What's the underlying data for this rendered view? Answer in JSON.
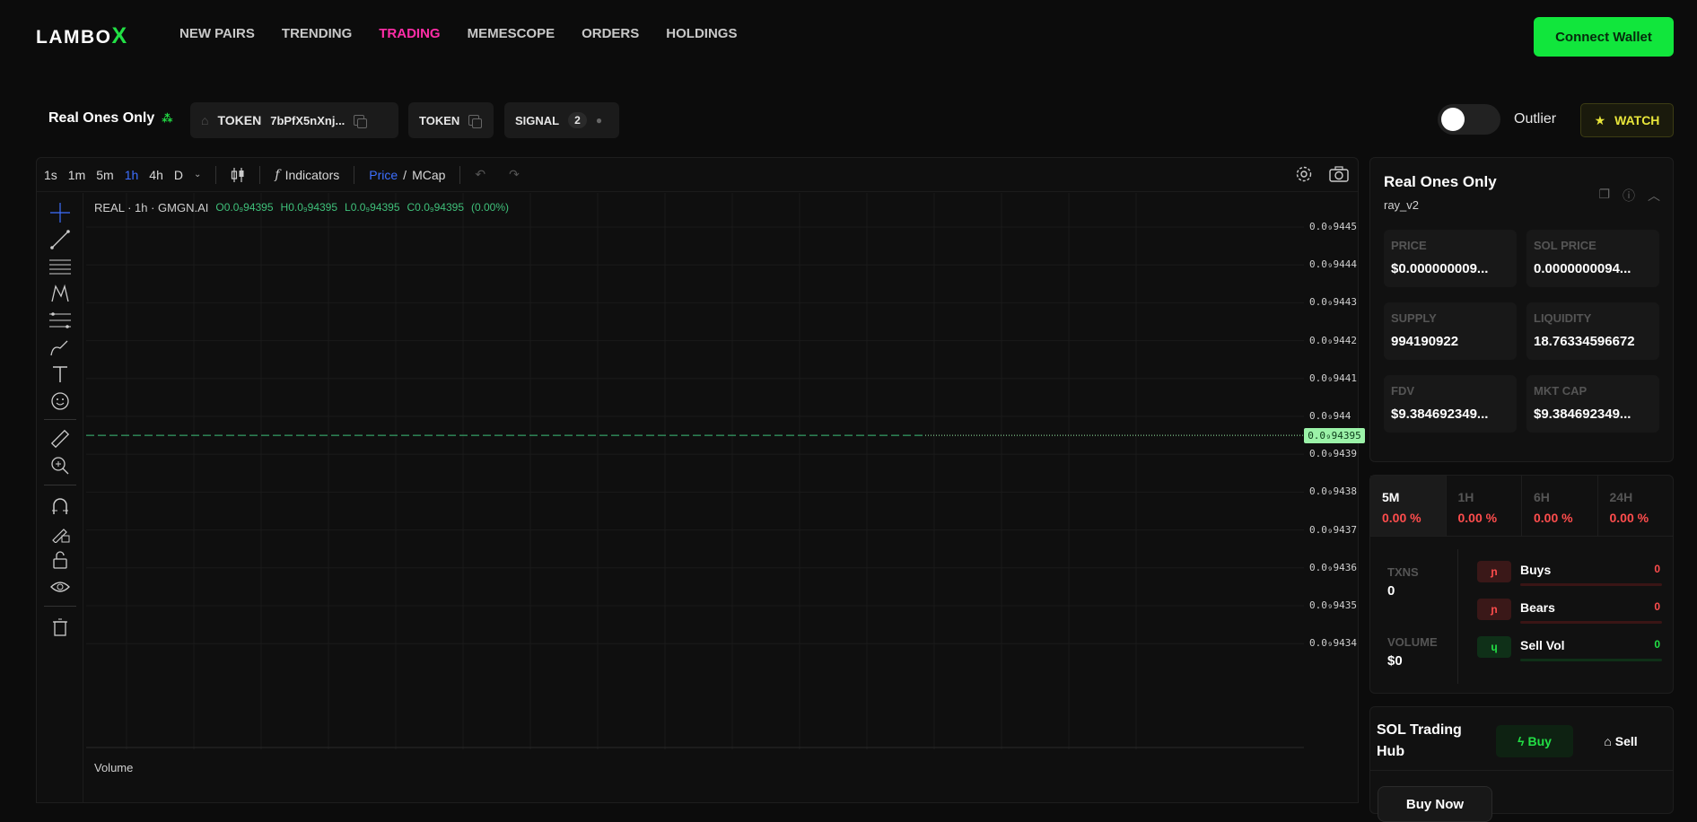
{
  "brand": {
    "logo_main": "LAMBO",
    "logo_x": "X"
  },
  "nav": [
    "NEW PAIRS",
    "TRENDING",
    "TRADING",
    "MEMESCOPE",
    "ORDERS",
    "HOLDINGS"
  ],
  "nav_active": "TRADING",
  "connect_label": "Connect Wallet",
  "infobar": {
    "token_name": "Real Ones Only",
    "chip1_label": "TOKEN",
    "chip1_address": "7bPfX5nXnj...",
    "chip2_label": "TOKEN",
    "chip3_label": "SIGNAL",
    "chip3_count": "2",
    "outlier_label": "Outlier",
    "watch_label": "WATCH"
  },
  "chart_toolbar": {
    "timeframes": [
      "1s",
      "1m",
      "5m",
      "1h",
      "4h",
      "D"
    ],
    "active_timeframe": "1h",
    "indicators_label": "Indicators",
    "price_label": "Price",
    "slash": "/",
    "mcap_label": "MCap"
  },
  "chart_legend": {
    "symbol": "REAL · 1h · GMGN.AI",
    "o": "O0.0₉94395",
    "h": "H0.0₉94395",
    "l": "L0.0₉94395",
    "c": "C0.0₉94395",
    "chg": "(0.00%)"
  },
  "chart_data": {
    "type": "line",
    "title": "",
    "xlabel": "",
    "ylabel": "",
    "y_ticks": [
      "0.0₉9445",
      "0.0₉9444",
      "0.0₉9443",
      "0.0₉9442",
      "0.0₉9441",
      "0.0₉944",
      "0.0₉9439",
      "0.0₉9438",
      "0.0₉9437",
      "0.0₉9436",
      "0.0₉9435",
      "0.0₉9434"
    ],
    "last_price_label": "0.0₉94395",
    "volume_label": "Volume",
    "grid": true
  },
  "token_card": {
    "title": "Real Ones Only",
    "subtitle": "ray_v2",
    "stats": [
      {
        "label": "PRICE",
        "value": "$0.000000009..."
      },
      {
        "label": "SOL PRICE",
        "value": "0.0000000094..."
      },
      {
        "label": "SUPPLY",
        "value": "994190922"
      },
      {
        "label": "LIQUIDITY",
        "value": "18.76334596672"
      },
      {
        "label": "FDV",
        "value": "$9.384692349..."
      },
      {
        "label": "MKT CAP",
        "value": "$9.384692349..."
      }
    ]
  },
  "txn_card": {
    "tabs": [
      {
        "label": "5M",
        "value": "0.00 %"
      },
      {
        "label": "1H",
        "value": "0.00 %"
      },
      {
        "label": "6H",
        "value": "0.00 %"
      },
      {
        "label": "24H",
        "value": "0.00 %"
      }
    ],
    "txns_label": "TXNS",
    "txns_value": "0",
    "volume_label": "VOLUME",
    "volume_value": "$0",
    "rows": [
      {
        "label": "Buys",
        "value": "0",
        "color": "#ff4d4d"
      },
      {
        "label": "Bears",
        "value": "0",
        "color": "#ff4d4d"
      },
      {
        "label": "Sell Vol",
        "value": "0",
        "color": "#22e045"
      }
    ]
  },
  "hub": {
    "title": "SOL Trading Hub",
    "buy_label": "Buy",
    "sell_label": "Sell",
    "buy_now_label": "Buy Now"
  },
  "colors": {
    "accent_green": "#11e63c",
    "nav_active": "#ff2da7",
    "watch": "#e8e53a",
    "negative": "#ff4d4d"
  }
}
